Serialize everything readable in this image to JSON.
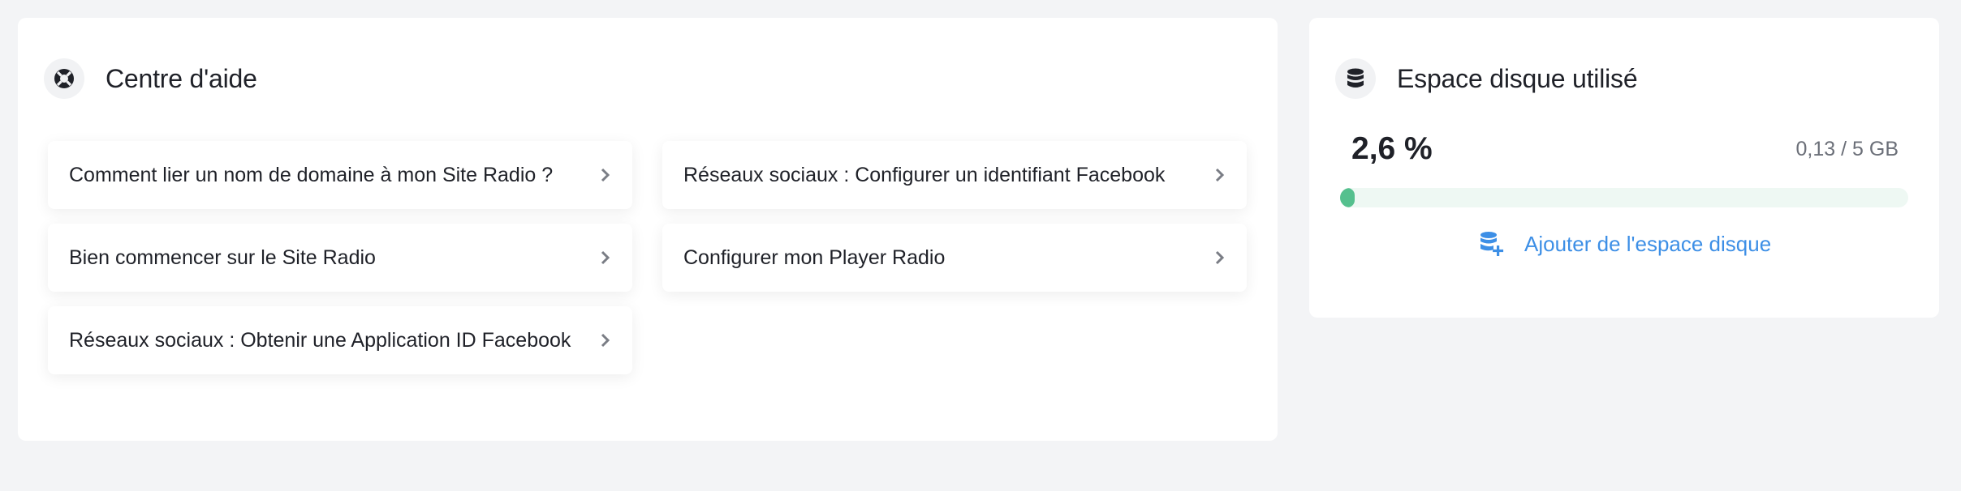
{
  "help_center": {
    "title": "Centre d'aide",
    "icon": "lifebuoy-icon",
    "articles": [
      {
        "label": "Comment lier un nom de domaine à mon Site Radio ?"
      },
      {
        "label": "Réseaux sociaux : Configurer un identifiant Facebook"
      },
      {
        "label": "Bien commencer sur le Site Radio"
      },
      {
        "label": "Configurer mon Player Radio"
      },
      {
        "label": "Réseaux sociaux : Obtenir une Application ID Facebook"
      }
    ]
  },
  "disk_space": {
    "title": "Espace disque utilisé",
    "icon": "database-icon",
    "percent_label": "2,6 %",
    "usage_label": "0,13 / 5 GB",
    "progress_fraction": 0.026,
    "add_link_label": "Ajouter de l'espace disque",
    "add_link_icon": "database-plus-icon"
  },
  "colors": {
    "background": "#f3f4f6",
    "progress_fill": "#55c08e",
    "progress_track": "#eef8f3",
    "link": "#3d8fe6"
  }
}
